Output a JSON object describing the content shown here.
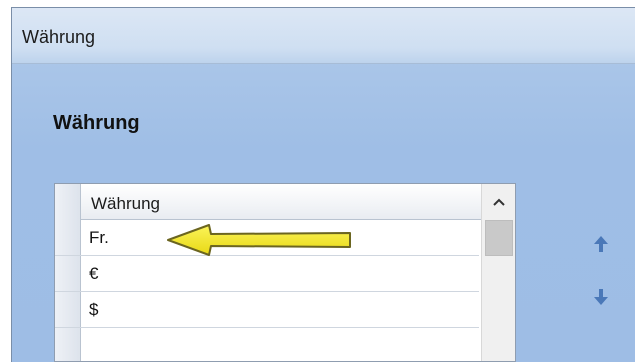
{
  "window": {
    "title": "Währung"
  },
  "section": {
    "heading": "Währung"
  },
  "grid": {
    "column_header": "Währung",
    "rows": [
      {
        "value": "Fr."
      },
      {
        "value": "€"
      },
      {
        "value": "$"
      },
      {
        "value": ""
      }
    ]
  },
  "icons": {
    "move_up": "arrow-up-icon",
    "move_down": "arrow-down-icon",
    "scroll_up": "chevron-up-icon",
    "annotation": "yellow-arrow-icon"
  },
  "colors": {
    "move_arrow": "#4a78b8",
    "annotation_fill": "#f5ea1c",
    "annotation_stroke": "#6b6520"
  }
}
